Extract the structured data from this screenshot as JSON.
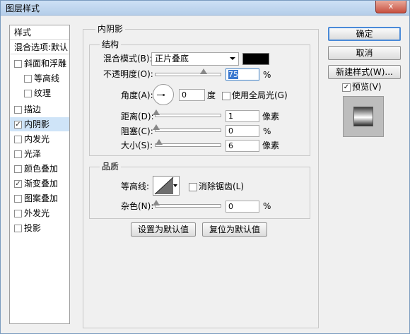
{
  "window": {
    "title": "图层样式",
    "close": "x"
  },
  "sidebar": {
    "header_style": "样式",
    "header_blend": "混合选项:默认",
    "items": [
      {
        "label": "斜面和浮雕",
        "checked": ""
      },
      {
        "label": "等高线",
        "checked": ""
      },
      {
        "label": "纹理",
        "checked": ""
      },
      {
        "label": "描边",
        "checked": ""
      },
      {
        "label": "内阴影",
        "checked": "✓"
      },
      {
        "label": "内发光",
        "checked": ""
      },
      {
        "label": "光泽",
        "checked": ""
      },
      {
        "label": "颜色叠加",
        "checked": ""
      },
      {
        "label": "渐变叠加",
        "checked": "✓"
      },
      {
        "label": "图案叠加",
        "checked": ""
      },
      {
        "label": "外发光",
        "checked": ""
      },
      {
        "label": "投影",
        "checked": ""
      }
    ]
  },
  "panel": {
    "title": "内阴影",
    "structure": {
      "title": "结构",
      "blend_mode_label": "混合模式(B):",
      "blend_mode_value": "正片叠底",
      "opacity_label": "不透明度(O):",
      "opacity_value": "75",
      "opacity_unit": "%",
      "angle_label": "角度(A):",
      "angle_value": "0",
      "angle_unit": "度",
      "global_light_label": "使用全局光(G)",
      "distance_label": "距离(D):",
      "distance_value": "1",
      "distance_unit": "像素",
      "choke_label": "阻塞(C):",
      "choke_value": "0",
      "choke_unit": "%",
      "size_label": "大小(S):",
      "size_value": "6",
      "size_unit": "像素"
    },
    "quality": {
      "title": "品质",
      "contour_label": "等高线:",
      "antialias_label": "消除锯齿(L)",
      "noise_label": "杂色(N):",
      "noise_value": "0",
      "noise_unit": "%"
    },
    "make_default": "设置为默认值",
    "reset_default": "复位为默认值"
  },
  "actions": {
    "ok": "确定",
    "cancel": "取消",
    "new_style": "新建样式(W)...",
    "preview_label": "预览(V)",
    "preview_checked": "✓"
  },
  "colors": {
    "shadow_color": "#000000",
    "accent": "#3b79d0"
  }
}
